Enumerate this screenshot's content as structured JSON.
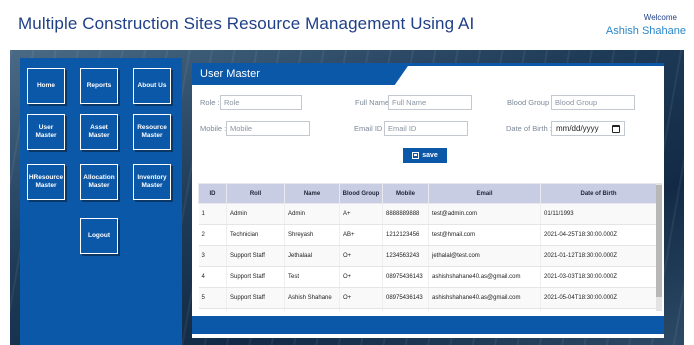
{
  "header": {
    "title": "Multiple Construction Sites Resource Management Using AI",
    "welcome_label": "Welcome",
    "user_name": "Ashish Shahane"
  },
  "sidebar": {
    "items": [
      {
        "label": "Home"
      },
      {
        "label": "Reports"
      },
      {
        "label": "About Us"
      },
      {
        "label": "User Master"
      },
      {
        "label": "Asset Master"
      },
      {
        "label": "Resource Master"
      },
      {
        "label": "HResource Master"
      },
      {
        "label": "Allocation Master"
      },
      {
        "label": "Inventory Master"
      },
      {
        "label": "Logout"
      }
    ]
  },
  "panel": {
    "title": "User Master",
    "save_label": "save"
  },
  "form": {
    "role": {
      "label": "Role :",
      "placeholder": "Role"
    },
    "full_name": {
      "label": "Full Name :",
      "placeholder": "Full Name"
    },
    "blood_group": {
      "label": "Blood Group :",
      "placeholder": "Blood Group"
    },
    "mobile": {
      "label": "Mobile :",
      "placeholder": "Mobile"
    },
    "email": {
      "label": "Email ID :",
      "placeholder": "Email ID"
    },
    "dob": {
      "label": "Date of Birth :",
      "value": "mm/dd/yyyy"
    }
  },
  "table": {
    "columns": [
      "ID",
      "Roll",
      "Name",
      "Blood Group",
      "Mobile",
      "Email",
      "Date of Birth"
    ],
    "rows": [
      [
        "1",
        "Admin",
        "Admin",
        "A+",
        "8888889888",
        "test@admin.com",
        "01/11/1993"
      ],
      [
        "2",
        "Technician",
        "Shreyash",
        "AB+",
        "1212123456",
        "test@hmail.com",
        "2021-04-25T18:30:00.000Z"
      ],
      [
        "3",
        "Support Staff",
        "Jethalaal",
        "O+",
        "1234563243",
        "jethalal@test.com",
        "2021-01-12T18:30:00.000Z"
      ],
      [
        "4",
        "Support Staff",
        "Test",
        "O+",
        "08975436143",
        "ashishshahane40.as@gmail.com",
        "2021-03-03T18:30:00.000Z"
      ],
      [
        "5",
        "Support Staff",
        "Ashish Shahane",
        "O+",
        "08975436143",
        "ashishshahane40.as@gmail.com",
        "2021-05-04T18:30:00.000Z"
      ],
      [
        "",
        "",
        "",
        "",
        "",
        "",
        ""
      ]
    ]
  },
  "colors": {
    "brand_blue": "#0b58a8",
    "title_blue": "#1f3f86",
    "table_header": "#c9cde4"
  }
}
